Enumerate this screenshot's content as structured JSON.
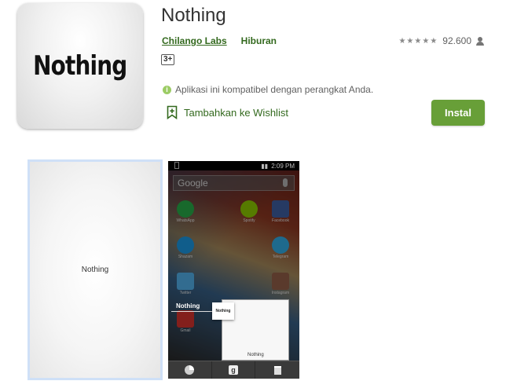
{
  "app": {
    "icon_text": "Nothing",
    "title": "Nothing",
    "developer": "Chilango Labs",
    "category": "Hiburan",
    "content_rating": "3+",
    "rating_count": "92.600",
    "rating_stars": 4.5,
    "compatibility_text": "Aplikasi ini kompatibel dengan perangkat Anda.",
    "wishlist_label": "Tambahkan ke Wishlist",
    "install_label": "Instal",
    "accent_color": "#689f38"
  },
  "screenshots": {
    "shot1_text": "Nothing",
    "shot2": {
      "status_time": "2:09 PM",
      "search_hint": "Google",
      "apps": [
        "WhatsApp",
        "Spotify",
        "Facebook",
        "Shazam",
        "Telegram",
        "Twitter",
        "Instagram",
        "Gmail",
        "Google"
      ],
      "drop_label": "Nothing",
      "mini_card_text": "Nothing",
      "big_card_text": "Nothing",
      "nav_g": "g"
    }
  }
}
